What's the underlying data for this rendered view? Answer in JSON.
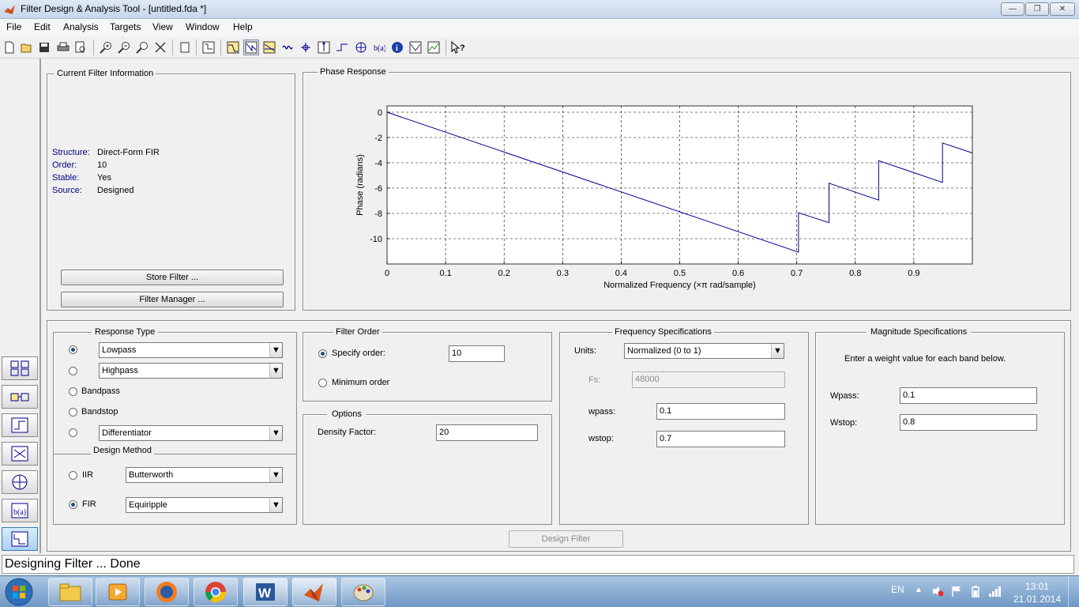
{
  "window": {
    "title": "Filter Design & Analysis Tool -  [untitled.fda *]"
  },
  "menu": [
    "File",
    "Edit",
    "Analysis",
    "Targets",
    "View",
    "Window",
    "Help"
  ],
  "current_filter": {
    "title": "Current Filter Information",
    "structure_label": "Structure:",
    "structure_value": "Direct-Form FIR",
    "order_label": "Order:",
    "order_value": "10",
    "stable_label": "Stable:",
    "stable_value": "Yes",
    "source_label": "Source:",
    "source_value": "Designed",
    "store_button": "Store Filter ...",
    "manager_button": "Filter Manager ..."
  },
  "phase_panel": {
    "title": "Phase Response"
  },
  "chart_data": {
    "type": "line",
    "title": "",
    "xlabel": "Normalized Frequency (×π rad/sample)",
    "ylabel": "Phase (radians)",
    "xlim": [
      0,
      1
    ],
    "ylim": [
      -12,
      0.5
    ],
    "xticks": [
      "0",
      "0.1",
      "0.2",
      "0.3",
      "0.4",
      "0.5",
      "0.6",
      "0.7",
      "0.8",
      "0.9"
    ],
    "yticks": [
      "0",
      "-2",
      "-4",
      "-6",
      "-8",
      "-10"
    ],
    "grid": true,
    "line_color": "#00008b",
    "x": [
      0,
      0.703,
      0.703,
      0.755,
      0.755,
      0.84,
      0.84,
      0.949,
      0.949,
      1.0
    ],
    "y": [
      0,
      -11.07,
      -7.95,
      -8.73,
      -5.61,
      -6.95,
      -3.83,
      -5.55,
      -2.43,
      -3.22
    ]
  },
  "response_type": {
    "title": "Response Type",
    "lowpass": "Lowpass",
    "highpass": "Highpass",
    "bandpass": "Bandpass",
    "bandstop": "Bandstop",
    "differentiator": "Differentiator"
  },
  "design_method": {
    "title": "Design Method",
    "iir_label": "IIR",
    "iir_value": "Butterworth",
    "fir_label": "FIR",
    "fir_value": "Equiripple"
  },
  "filter_order": {
    "title": "Filter Order",
    "specify_label": "Specify order:",
    "specify_value": "10",
    "minimum_label": "Minimum order"
  },
  "options": {
    "title": "Options",
    "density_label": "Density Factor:",
    "density_value": "20"
  },
  "frequency_specs": {
    "title": "Frequency Specifications",
    "units_label": "Units:",
    "units_value": "Normalized (0 to 1)",
    "fs_label": "Fs:",
    "fs_value": "48000",
    "wpass_label": "wpass:",
    "wpass_value": "0.1",
    "wstop_label": "wstop:",
    "wstop_value": "0.7"
  },
  "magnitude_specs": {
    "title": "Magnitude Specifications",
    "instruction": "Enter a weight value for each band below.",
    "wpass_label": "Wpass:",
    "wpass_value": "0.1",
    "wstop_label": "Wstop:",
    "wstop_value": "0.8"
  },
  "design_button": "Design Filter",
  "status": "Designing Filter ... Done",
  "taskbar": {
    "lang": "EN",
    "time": "13:01",
    "date": "21.01.2014"
  }
}
